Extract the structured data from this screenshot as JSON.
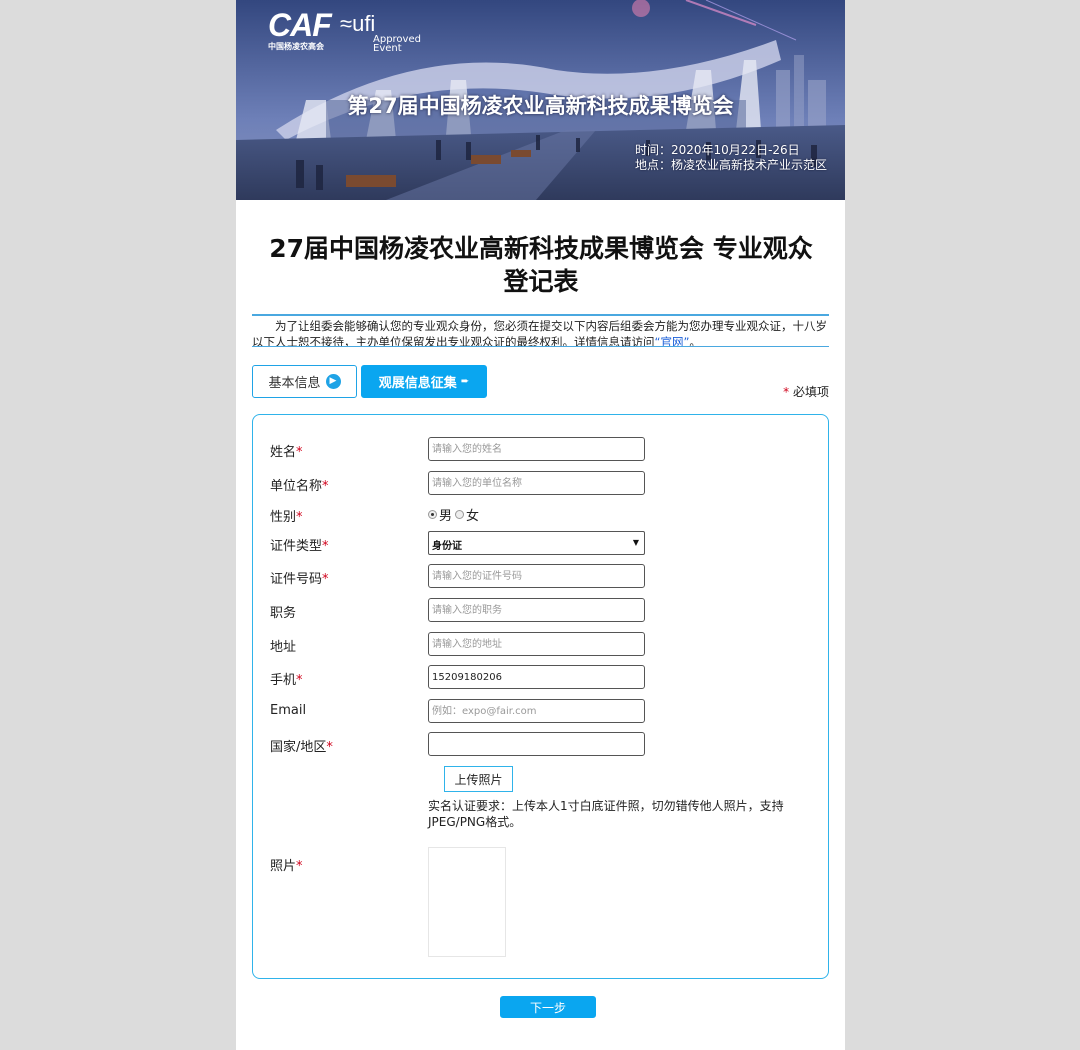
{
  "banner": {
    "logo_caf": "CAF",
    "logo_caf_sub": "中国杨凌农高会",
    "logo_ufi": "ufi",
    "logo_ufi_approved": "Approved",
    "logo_ufi_event": "Event",
    "title": "第27届中国杨凌农业高新科技成果博览会",
    "time": "时间：2020年10月22日-26日",
    "location": "地点：杨凌农业高新技术产业示范区"
  },
  "heading": "27届中国杨凌农业高新科技成果博览会 专业观众登记表",
  "intro": {
    "text": "为了让组委会能够确认您的专业观众身份，您必须在提交以下内容后组委会方能为您办理专业观众证，十八岁以下人士恕不接待，主办单位保留发出专业观众证的最终权利。详情信息请访问",
    "link": "“官网”",
    "suffix": "。"
  },
  "tabs": {
    "basic": "基本信息",
    "expo": "观展信息征集"
  },
  "required_note": {
    "star": "*",
    "text": " 必填项"
  },
  "form": {
    "star": "*",
    "name": {
      "label": "姓名",
      "placeholder": "请输入您的姓名"
    },
    "company": {
      "label": "单位名称",
      "placeholder": "请输入您的单位名称"
    },
    "gender": {
      "label": "性别",
      "male": "男",
      "female": "女"
    },
    "id_type": {
      "label": "证件类型",
      "value": "身份证"
    },
    "id_number": {
      "label": "证件号码",
      "placeholder": "请输入您的证件号码"
    },
    "position": {
      "label": "职务",
      "placeholder": "请输入您的职务"
    },
    "address": {
      "label": "地址",
      "placeholder": "请输入您的地址"
    },
    "phone": {
      "label": "手机",
      "value": "15209180206"
    },
    "email": {
      "label": "Email",
      "placeholder": "例如：expo@fair.com"
    },
    "country": {
      "label": "国家/地区",
      "value": ""
    },
    "upload_button": "上传照片",
    "upload_note": "实名认证要求：上传本人1寸白底证件照，切勿错传他人照片，支持JPEG/PNG格式。",
    "photo": {
      "label": "照片"
    }
  },
  "next_button": "下一步"
}
